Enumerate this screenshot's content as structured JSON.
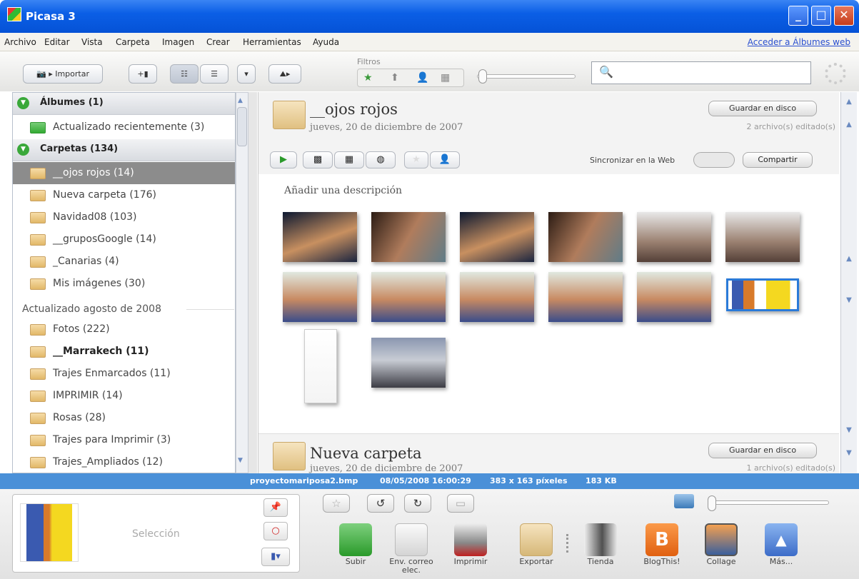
{
  "window": {
    "title": "Picasa 3"
  },
  "menu": {
    "items": [
      "Archivo",
      "Editar",
      "Vista",
      "Carpeta",
      "Imagen",
      "Crear",
      "Herramientas",
      "Ayuda"
    ],
    "login_link": "Acceder a Álbumes web"
  },
  "toolbar": {
    "import_label": "Importar",
    "filters_label": "Filtros"
  },
  "sidebar": {
    "albums_header": "Álbumes (1)",
    "recent": "Actualizado recientemente (3)",
    "folders_header": "Carpetas (134)",
    "section_label": "Actualizado agosto de 2008",
    "items": [
      {
        "label": "__ojos rojos (14)"
      },
      {
        "label": "Nueva carpeta (176)"
      },
      {
        "label": "Navidad08 (103)"
      },
      {
        "label": "__gruposGoogle (14)"
      },
      {
        "label": "_Canarias (4)"
      },
      {
        "label": "Mis imágenes (30)"
      },
      {
        "label": "Fotos (222)"
      },
      {
        "label": "__Marrakech (11)"
      },
      {
        "label": "Trajes Enmarcados (11)"
      },
      {
        "label": "IMPRIMIR (14)"
      },
      {
        "label": "Rosas (28)"
      },
      {
        "label": "Trajes para Imprimir (3)"
      },
      {
        "label": "Trajes_Ampliados (12)"
      }
    ]
  },
  "album1": {
    "title": "__ojos rojos",
    "date": "jueves, 20 de diciembre de 2007",
    "save_label": "Guardar en disco",
    "edited": "2 archivo(s) editado(s)",
    "sync_label": "Sincronizar en la Web",
    "share_label": "Compartir",
    "description_placeholder": "Añadir una descripción"
  },
  "album2": {
    "title": "Nueva carpeta",
    "date": "jueves, 20 de diciembre de 2007",
    "save_label": "Guardar en disco",
    "edited": "1 archivo(s) editado(s)"
  },
  "status": {
    "filename": "proyectomariposa2.bmp",
    "datetime": "08/05/2008 16:00:29",
    "dimensions": "383 x 163 píxeles",
    "size": "183 KB"
  },
  "tray": {
    "selection_label": "Selección"
  },
  "actions": [
    {
      "label": "Subir",
      "icon": "upload-arrow-icon",
      "color": "#3aa83a"
    },
    {
      "label": "Env. correo elec.",
      "icon": "envelope-icon",
      "color": "#e8e8e8"
    },
    {
      "label": "Imprimir",
      "icon": "printer-icon",
      "color": "#9a9a9a"
    },
    {
      "label": "Exportar",
      "icon": "folder-icon",
      "color": "#e6c88e"
    },
    {
      "label": "Tienda",
      "icon": "shop-icon",
      "color": "#7a7a7a"
    },
    {
      "label": "BlogThis!",
      "icon": "blogger-icon",
      "color": "#f37a1f"
    },
    {
      "label": "Collage",
      "icon": "collage-icon",
      "color": "#3b5f9c"
    },
    {
      "label": "Más...",
      "icon": "more-up-icon",
      "color": "#4a7fd0"
    }
  ]
}
